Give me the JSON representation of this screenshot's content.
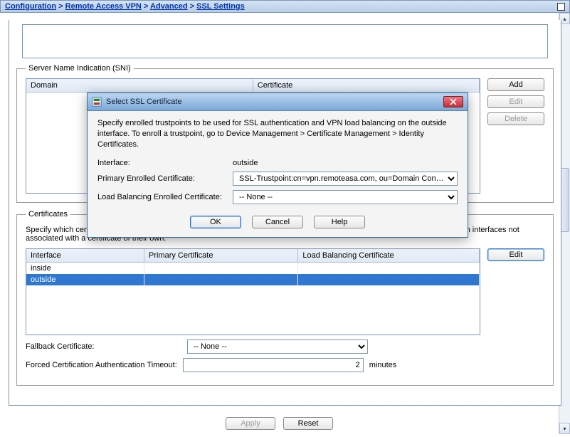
{
  "breadcrumb": {
    "parts": [
      "Configuration",
      "Remote Access VPN",
      "Advanced"
    ],
    "current": "SSL Settings"
  },
  "sni": {
    "legend": "Server Name Indication (SNI)",
    "columns": [
      "Domain",
      "Certificate"
    ],
    "buttons": {
      "add": "Add",
      "edit": "Edit",
      "delete": "Delete"
    }
  },
  "certs": {
    "legend": "Certificates",
    "desc": "Specify which certificates, if any, should be used for SSL authentication on each interface. The fallback certificate will be used on interfaces not associated with a certificate of their own.",
    "columns": [
      "Interface",
      "Primary Certificate",
      "Load Balancing Certificate"
    ],
    "rows": [
      {
        "iface": "inside",
        "primary": "",
        "lb": ""
      },
      {
        "iface": "outside",
        "primary": "",
        "lb": ""
      }
    ],
    "edit": "Edit"
  },
  "fallback": {
    "label": "Fallback Certificate:",
    "value": "-- None --"
  },
  "timeout": {
    "label": "Forced Certification Authentication Timeout:",
    "value": "2",
    "unit": "minutes"
  },
  "footer": {
    "apply": "Apply",
    "reset": "Reset"
  },
  "dialog": {
    "title": "Select SSL Certificate",
    "desc": "Specify enrolled trustpoints to be used for SSL authentication and VPN load balancing on the outside interface. To enroll a trustpoint, go to Device Management > Certificate Management > Identity Certificates.",
    "iface_label": "Interface:",
    "iface_value": "outside",
    "primary_label": "Primary Enrolled Certificate:",
    "primary_value": "SSL-Trustpoint:cn=vpn.remoteasa.com, ou=Domain Con…",
    "lb_label": "Load Balancing Enrolled Certificate:",
    "lb_value": "-- None --",
    "ok": "OK",
    "cancel": "Cancel",
    "help": "Help"
  }
}
